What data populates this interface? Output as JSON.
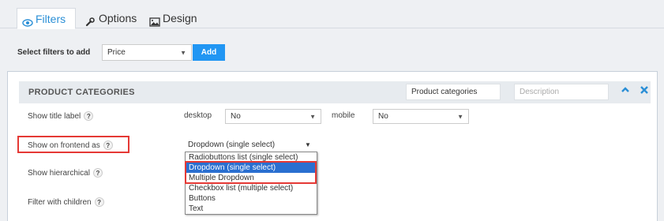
{
  "tabs": [
    {
      "label": "Filters",
      "icon": "eye-icon",
      "active": true
    },
    {
      "label": "Options",
      "icon": "wrench-icon",
      "active": false
    },
    {
      "label": "Design",
      "icon": "image-icon",
      "active": false
    }
  ],
  "filter_picker": {
    "label": "Select filters to add",
    "selected": "Price",
    "add_label": "Add"
  },
  "panel": {
    "title": "PRODUCT CATEGORIES",
    "title_input_value": "Product categories",
    "description_placeholder": "Description",
    "collapse_icon": "chevron-up-icon",
    "close_icon": "close-icon"
  },
  "rows": {
    "show_title_label": {
      "label": "Show title label",
      "desktop_label": "desktop",
      "desktop_value": "No",
      "mobile_label": "mobile",
      "mobile_value": "No"
    },
    "show_on_frontend": {
      "label": "Show on frontend as",
      "value": "Dropdown (single select)"
    },
    "show_hierarchical": {
      "label": "Show hierarchical"
    },
    "filter_with_children": {
      "label": "Filter with children"
    }
  },
  "help_glyph": "?",
  "dropdown_options": [
    "Radiobuttons list (single select)",
    "Dropdown (single select)",
    "Multiple Dropdown",
    "Checkbox list (multiple select)",
    "Buttons",
    "Text"
  ],
  "selected_option_index": 1,
  "colors": {
    "accent": "#2a8fd6",
    "add_button": "#2196f3",
    "highlight": "#e53935",
    "selected_option": "#2a6fd0"
  }
}
